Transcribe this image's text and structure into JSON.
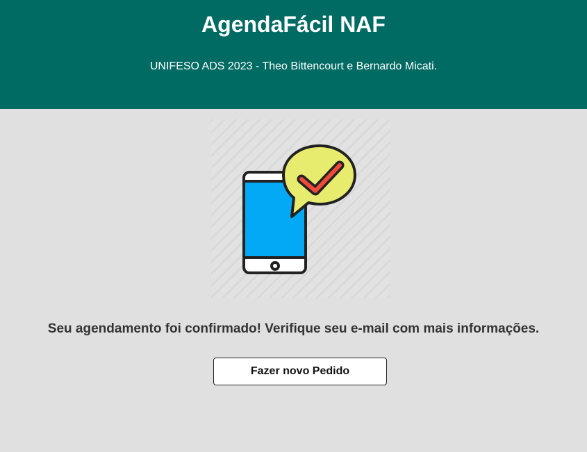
{
  "header": {
    "title": "AgendaFácil NAF",
    "subtitle": "UNIFESO ADS 2023 - Theo Bittencourt e Bernardo Micati."
  },
  "confirmation": {
    "illustration": "phone-chat-checkmark-icon",
    "message": "Seu agendamento foi confirmado! Verifique seu e-mail com mais informações.",
    "new_order_label": "Fazer novo Pedido"
  },
  "colors": {
    "header_bg": "#006b63",
    "page_bg": "#e0e0e0",
    "phone_screen": "#03a9f4",
    "bubble": "#e8ec6e",
    "check": "#f04a3a"
  }
}
